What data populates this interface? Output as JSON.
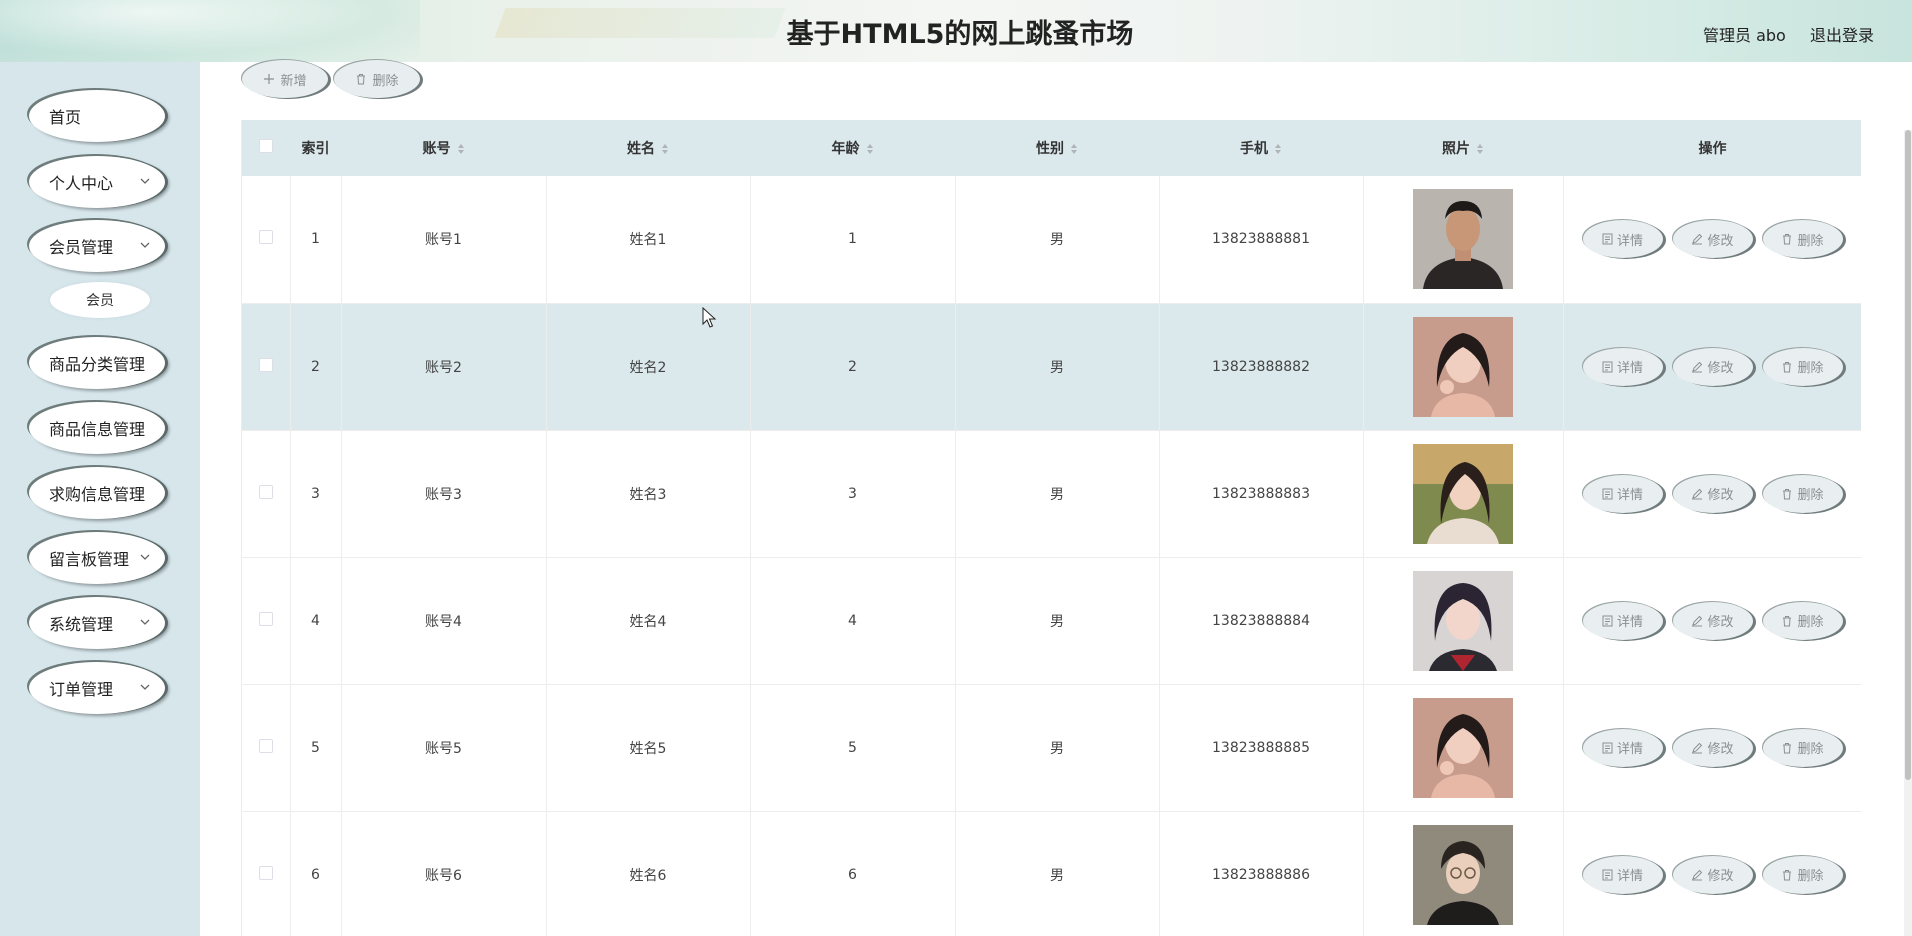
{
  "header": {
    "title": "基于HTML5的网上跳蚤市场",
    "user_text": "管理员 abo",
    "logout_label": "退出登录"
  },
  "sidebar": {
    "items": [
      {
        "label": "首页",
        "icon": "none"
      },
      {
        "label": "个人中心",
        "icon": "chevron-down-icon"
      },
      {
        "label": "会员管理",
        "icon": "chevron-down-icon"
      },
      {
        "label": "商品分类管理",
        "icon": "none"
      },
      {
        "label": "商品信息管理",
        "icon": "none"
      },
      {
        "label": "求购信息管理",
        "icon": "none"
      },
      {
        "label": "留言板管理",
        "icon": "chevron-down-icon"
      },
      {
        "label": "系统管理",
        "icon": "chevron-down-icon"
      },
      {
        "label": "订单管理",
        "icon": "chevron-down-icon"
      }
    ],
    "sub_item": "会员"
  },
  "toolbar": {
    "add_label": "新增",
    "delete_label": "删除"
  },
  "table": {
    "headers": [
      "索引",
      "账号",
      "姓名",
      "年龄",
      "性别",
      "手机",
      "照片",
      "操作"
    ],
    "rows": [
      {
        "index": "1",
        "account": "账号1",
        "name": "姓名1",
        "age": "1",
        "gender": "男",
        "phone": "13823888881"
      },
      {
        "index": "2",
        "account": "账号2",
        "name": "姓名2",
        "age": "2",
        "gender": "男",
        "phone": "13823888882"
      },
      {
        "index": "3",
        "account": "账号3",
        "name": "姓名3",
        "age": "3",
        "gender": "男",
        "phone": "13823888883"
      },
      {
        "index": "4",
        "account": "账号4",
        "name": "姓名4",
        "age": "4",
        "gender": "男",
        "phone": "13823888884"
      },
      {
        "index": "5",
        "account": "账号5",
        "name": "姓名5",
        "age": "5",
        "gender": "男",
        "phone": "13823888885"
      },
      {
        "index": "6",
        "account": "账号6",
        "name": "姓名6",
        "age": "6",
        "gender": "男",
        "phone": "13823888886"
      }
    ],
    "actions": {
      "detail": "详情",
      "edit": "修改",
      "delete": "删除"
    }
  },
  "colors": {
    "sidebar_bg": "#d6e6eb",
    "table_header_bg": "#dbe8ec",
    "hover_row_bg": "#dbe8ec",
    "button_bg": "#e9eff0",
    "button_text": "#8a8f92"
  }
}
